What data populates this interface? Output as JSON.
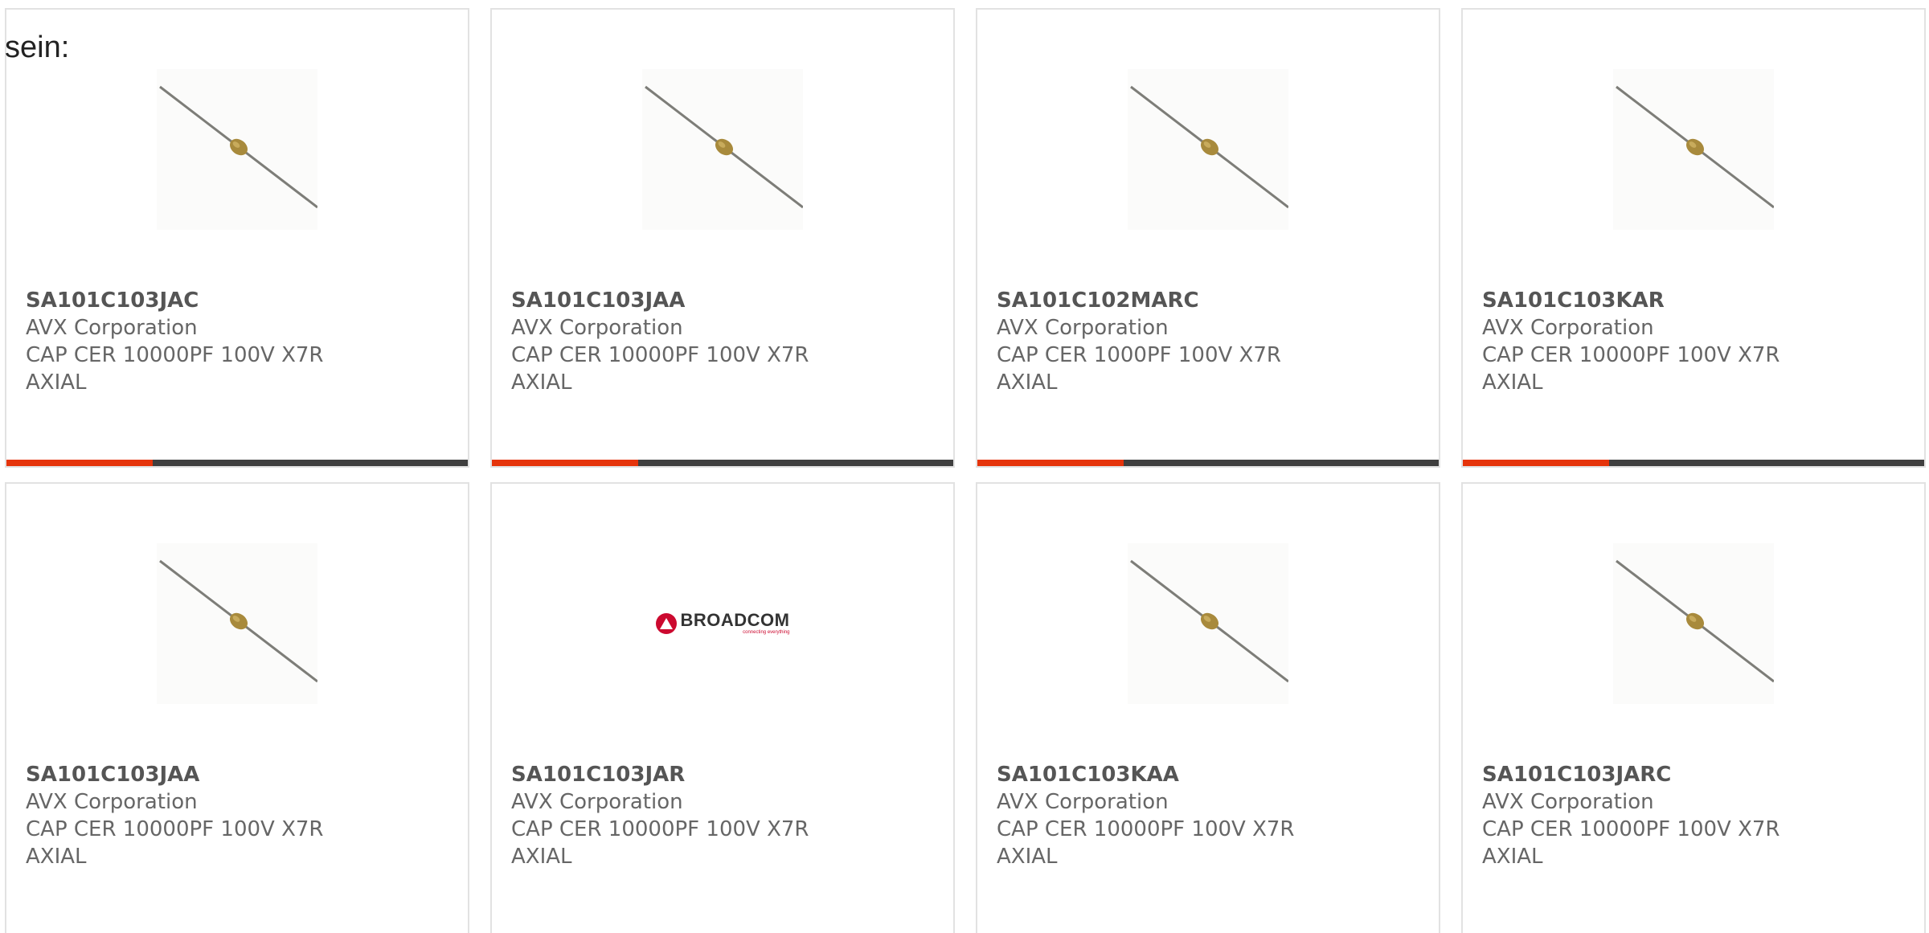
{
  "intro_text": "sein:",
  "cards": [
    {
      "part_number": "SA101C103JAC",
      "manufacturer": "AVX Corporation",
      "description": "CAP CER 10000PF 100V X7R AXIAL",
      "image": "axial-capacitor-image"
    },
    {
      "part_number": "SA101C103JAA",
      "manufacturer": "AVX Corporation",
      "description": "CAP CER 10000PF 100V X7R AXIAL",
      "image": "axial-capacitor-image"
    },
    {
      "part_number": "SA101C102MARC",
      "manufacturer": "AVX Corporation",
      "description": "CAP CER 1000PF 100V X7R AXIAL",
      "image": "axial-capacitor-image"
    },
    {
      "part_number": "SA101C103KAR",
      "manufacturer": "AVX Corporation",
      "description": "CAP CER 10000PF 100V X7R AXIAL",
      "image": "axial-capacitor-image"
    },
    {
      "part_number": "SA101C103JAA",
      "manufacturer": "AVX Corporation",
      "description": "CAP CER 10000PF 100V X7R AXIAL",
      "image": "axial-capacitor-image"
    },
    {
      "part_number": "SA101C103JAR",
      "manufacturer": "AVX Corporation",
      "description": "CAP CER 10000PF 100V X7R AXIAL",
      "image": "broadcom-logo",
      "logo_text": "BROADCOM",
      "logo_tagline": "connecting everything"
    },
    {
      "part_number": "SA101C103KAA",
      "manufacturer": "AVX Corporation",
      "description": "CAP CER 10000PF 100V X7R AXIAL",
      "image": "axial-capacitor-image"
    },
    {
      "part_number": "SA101C103JARC",
      "manufacturer": "AVX Corporation",
      "description": "CAP CER 10000PF 100V X7R AXIAL",
      "image": "axial-capacitor-image"
    }
  ],
  "colors": {
    "accent": "#e5340b",
    "bar_dark": "#3f3f3f",
    "card_border": "#e2e2e2",
    "text": "#666666",
    "broadcom_red": "#cc092f"
  }
}
